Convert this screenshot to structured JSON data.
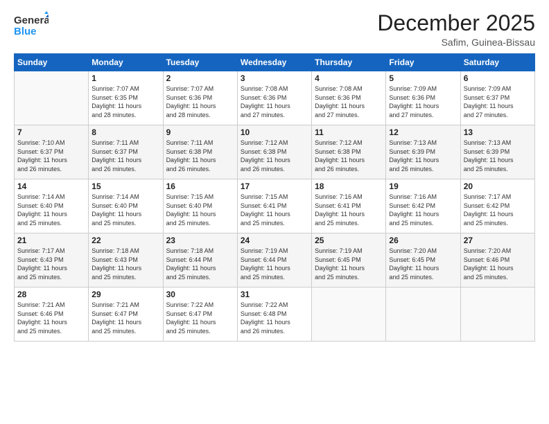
{
  "logo": {
    "line1": "General",
    "line2": "Blue"
  },
  "title": "December 2025",
  "location": "Safim, Guinea-Bissau",
  "days_of_week": [
    "Sunday",
    "Monday",
    "Tuesday",
    "Wednesday",
    "Thursday",
    "Friday",
    "Saturday"
  ],
  "weeks": [
    [
      {
        "day": "",
        "info": ""
      },
      {
        "day": "1",
        "info": "Sunrise: 7:07 AM\nSunset: 6:35 PM\nDaylight: 11 hours\nand 28 minutes."
      },
      {
        "day": "2",
        "info": "Sunrise: 7:07 AM\nSunset: 6:36 PM\nDaylight: 11 hours\nand 28 minutes."
      },
      {
        "day": "3",
        "info": "Sunrise: 7:08 AM\nSunset: 6:36 PM\nDaylight: 11 hours\nand 27 minutes."
      },
      {
        "day": "4",
        "info": "Sunrise: 7:08 AM\nSunset: 6:36 PM\nDaylight: 11 hours\nand 27 minutes."
      },
      {
        "day": "5",
        "info": "Sunrise: 7:09 AM\nSunset: 6:36 PM\nDaylight: 11 hours\nand 27 minutes."
      },
      {
        "day": "6",
        "info": "Sunrise: 7:09 AM\nSunset: 6:37 PM\nDaylight: 11 hours\nand 27 minutes."
      }
    ],
    [
      {
        "day": "7",
        "info": "Sunrise: 7:10 AM\nSunset: 6:37 PM\nDaylight: 11 hours\nand 26 minutes."
      },
      {
        "day": "8",
        "info": "Sunrise: 7:11 AM\nSunset: 6:37 PM\nDaylight: 11 hours\nand 26 minutes."
      },
      {
        "day": "9",
        "info": "Sunrise: 7:11 AM\nSunset: 6:38 PM\nDaylight: 11 hours\nand 26 minutes."
      },
      {
        "day": "10",
        "info": "Sunrise: 7:12 AM\nSunset: 6:38 PM\nDaylight: 11 hours\nand 26 minutes."
      },
      {
        "day": "11",
        "info": "Sunrise: 7:12 AM\nSunset: 6:38 PM\nDaylight: 11 hours\nand 26 minutes."
      },
      {
        "day": "12",
        "info": "Sunrise: 7:13 AM\nSunset: 6:39 PM\nDaylight: 11 hours\nand 26 minutes."
      },
      {
        "day": "13",
        "info": "Sunrise: 7:13 AM\nSunset: 6:39 PM\nDaylight: 11 hours\nand 25 minutes."
      }
    ],
    [
      {
        "day": "14",
        "info": "Sunrise: 7:14 AM\nSunset: 6:40 PM\nDaylight: 11 hours\nand 25 minutes."
      },
      {
        "day": "15",
        "info": "Sunrise: 7:14 AM\nSunset: 6:40 PM\nDaylight: 11 hours\nand 25 minutes."
      },
      {
        "day": "16",
        "info": "Sunrise: 7:15 AM\nSunset: 6:40 PM\nDaylight: 11 hours\nand 25 minutes."
      },
      {
        "day": "17",
        "info": "Sunrise: 7:15 AM\nSunset: 6:41 PM\nDaylight: 11 hours\nand 25 minutes."
      },
      {
        "day": "18",
        "info": "Sunrise: 7:16 AM\nSunset: 6:41 PM\nDaylight: 11 hours\nand 25 minutes."
      },
      {
        "day": "19",
        "info": "Sunrise: 7:16 AM\nSunset: 6:42 PM\nDaylight: 11 hours\nand 25 minutes."
      },
      {
        "day": "20",
        "info": "Sunrise: 7:17 AM\nSunset: 6:42 PM\nDaylight: 11 hours\nand 25 minutes."
      }
    ],
    [
      {
        "day": "21",
        "info": "Sunrise: 7:17 AM\nSunset: 6:43 PM\nDaylight: 11 hours\nand 25 minutes."
      },
      {
        "day": "22",
        "info": "Sunrise: 7:18 AM\nSunset: 6:43 PM\nDaylight: 11 hours\nand 25 minutes."
      },
      {
        "day": "23",
        "info": "Sunrise: 7:18 AM\nSunset: 6:44 PM\nDaylight: 11 hours\nand 25 minutes."
      },
      {
        "day": "24",
        "info": "Sunrise: 7:19 AM\nSunset: 6:44 PM\nDaylight: 11 hours\nand 25 minutes."
      },
      {
        "day": "25",
        "info": "Sunrise: 7:19 AM\nSunset: 6:45 PM\nDaylight: 11 hours\nand 25 minutes."
      },
      {
        "day": "26",
        "info": "Sunrise: 7:20 AM\nSunset: 6:45 PM\nDaylight: 11 hours\nand 25 minutes."
      },
      {
        "day": "27",
        "info": "Sunrise: 7:20 AM\nSunset: 6:46 PM\nDaylight: 11 hours\nand 25 minutes."
      }
    ],
    [
      {
        "day": "28",
        "info": "Sunrise: 7:21 AM\nSunset: 6:46 PM\nDaylight: 11 hours\nand 25 minutes."
      },
      {
        "day": "29",
        "info": "Sunrise: 7:21 AM\nSunset: 6:47 PM\nDaylight: 11 hours\nand 25 minutes."
      },
      {
        "day": "30",
        "info": "Sunrise: 7:22 AM\nSunset: 6:47 PM\nDaylight: 11 hours\nand 25 minutes."
      },
      {
        "day": "31",
        "info": "Sunrise: 7:22 AM\nSunset: 6:48 PM\nDaylight: 11 hours\nand 26 minutes."
      },
      {
        "day": "",
        "info": ""
      },
      {
        "day": "",
        "info": ""
      },
      {
        "day": "",
        "info": ""
      }
    ]
  ]
}
